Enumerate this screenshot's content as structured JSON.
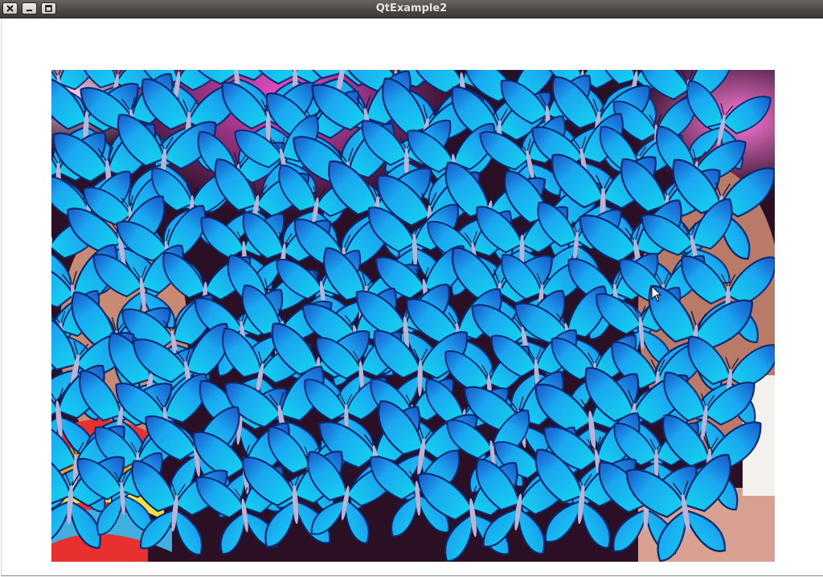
{
  "window": {
    "title": "QtExample2",
    "controls": {
      "close_icon": "close-icon",
      "minimize_icon": "minimize-icon",
      "maximize_icon": "maximize-icon"
    }
  },
  "scene": {
    "background_image": "crowd-photo",
    "sprite": "blue-butterfly",
    "colors": {
      "wing_light": "#12d8ee",
      "wing_mid": "#1aa6f0",
      "wing_dark": "#1a55c8",
      "body": "#b9b4d8"
    }
  }
}
